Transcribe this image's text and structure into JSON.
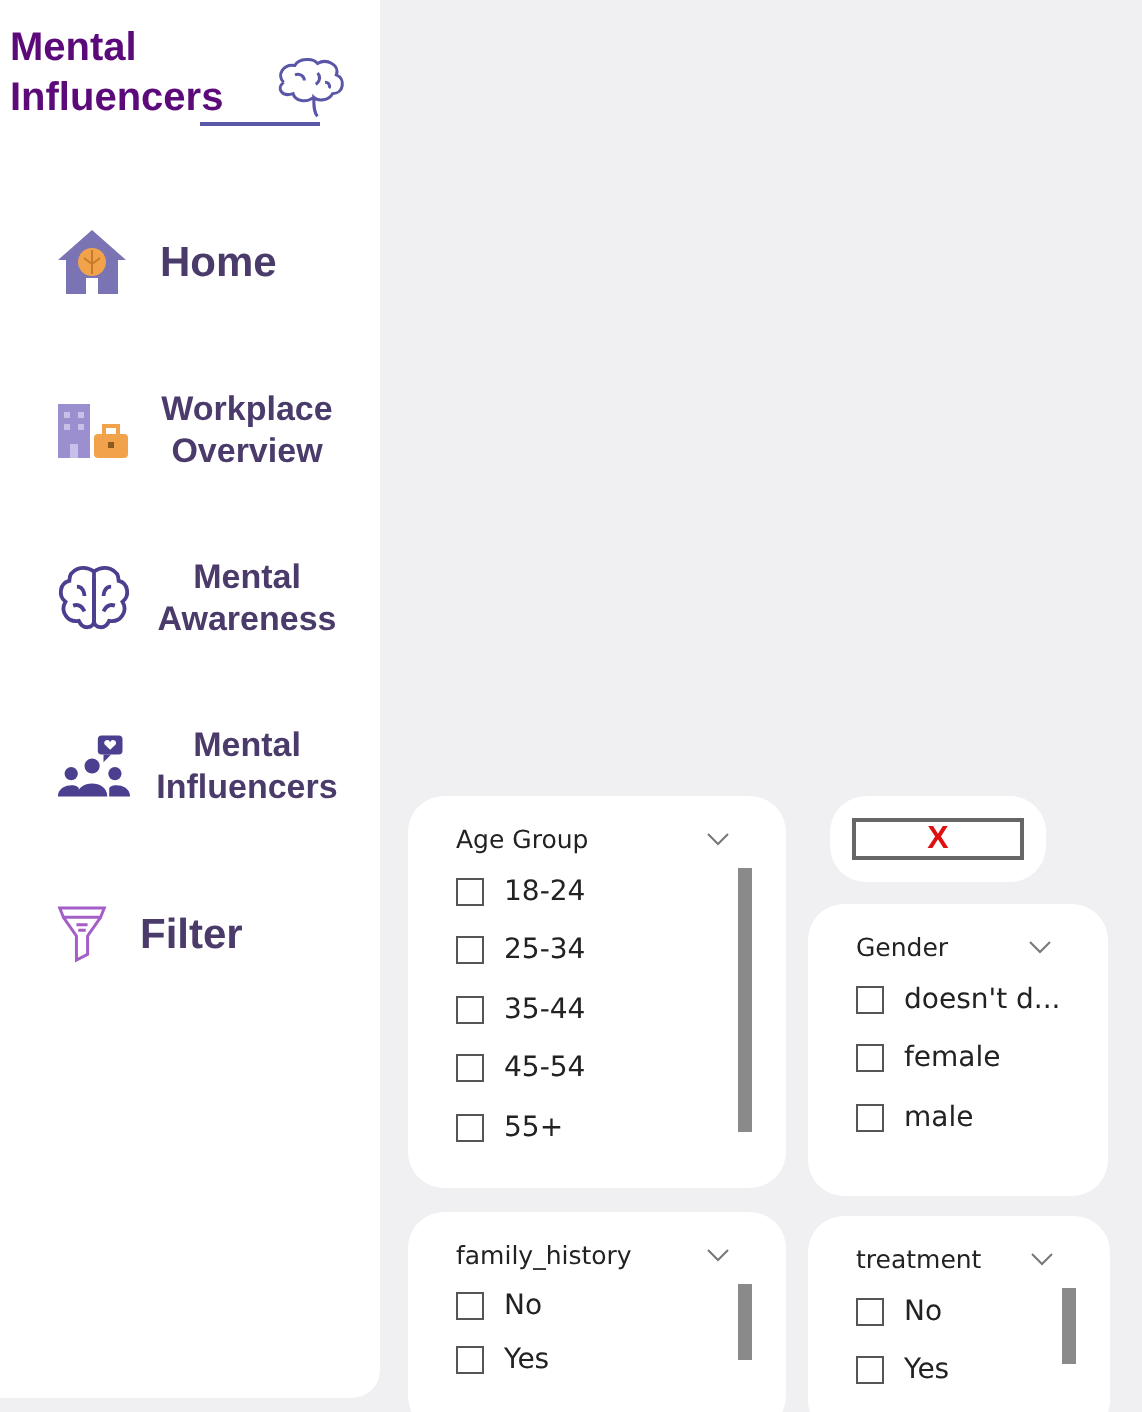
{
  "sidebar": {
    "title": "Mental Influencers",
    "items": [
      {
        "kind": "home",
        "label": "Home"
      },
      {
        "kind": "workplace",
        "label": "Workplace Overview"
      },
      {
        "kind": "awareness",
        "label": "Mental Awareness"
      },
      {
        "kind": "influencers",
        "label": "Mental Influencers"
      },
      {
        "kind": "filter",
        "label": "Filter"
      }
    ]
  },
  "clear_button": {
    "label": "X"
  },
  "slicers": [
    {
      "title": "Age Group",
      "options": [
        {
          "label": "18-24",
          "checked": false
        },
        {
          "label": "25-34",
          "checked": false
        },
        {
          "label": "35-44",
          "checked": false
        },
        {
          "label": "45-54",
          "checked": false
        },
        {
          "label": "55+",
          "checked": false
        }
      ]
    },
    {
      "title": "Gender",
      "options": [
        {
          "label": "doesn't d...",
          "checked": false
        },
        {
          "label": "female",
          "checked": false
        },
        {
          "label": "male",
          "checked": false
        }
      ]
    },
    {
      "title": "family_history",
      "options": [
        {
          "label": "No",
          "checked": false
        },
        {
          "label": "Yes",
          "checked": false
        }
      ]
    },
    {
      "title": "treatment",
      "options": [
        {
          "label": "No",
          "checked": false
        },
        {
          "label": "Yes",
          "checked": false
        }
      ]
    }
  ]
}
